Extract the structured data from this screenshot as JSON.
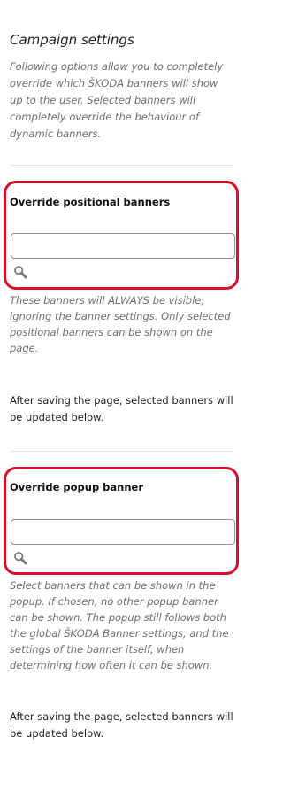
{
  "campaign": {
    "title": "Campaign settings",
    "description": "Following options allow you to completely override which ŠKODA banners will show up to the user. Selected banners will completely override the behaviour of dynamic banners."
  },
  "positional": {
    "label": "Override positional banners",
    "input_value": "",
    "search_icon": "magnifier-icon",
    "help": "These banners will ALWAYS be visible, ignoring the banner settings. Only selected positional banners can be shown on the page.",
    "note": "After saving the page, selected banners will be updated below."
  },
  "popup": {
    "label": "Override popup banner",
    "input_value": "",
    "search_icon": "magnifier-icon",
    "help": "Select banners that can be shown in the popup. If chosen, no other popup banner can be shown. The popup still follows both the global ŠKODA Banner settings, and the settings of the banner itself, when determining how often it can be shown.",
    "note": "After saving the page, selected banners will be updated below."
  },
  "colors": {
    "highlight": "#d6102a",
    "muted_text": "#6e6e6e",
    "input_border": "#8c8f94"
  }
}
